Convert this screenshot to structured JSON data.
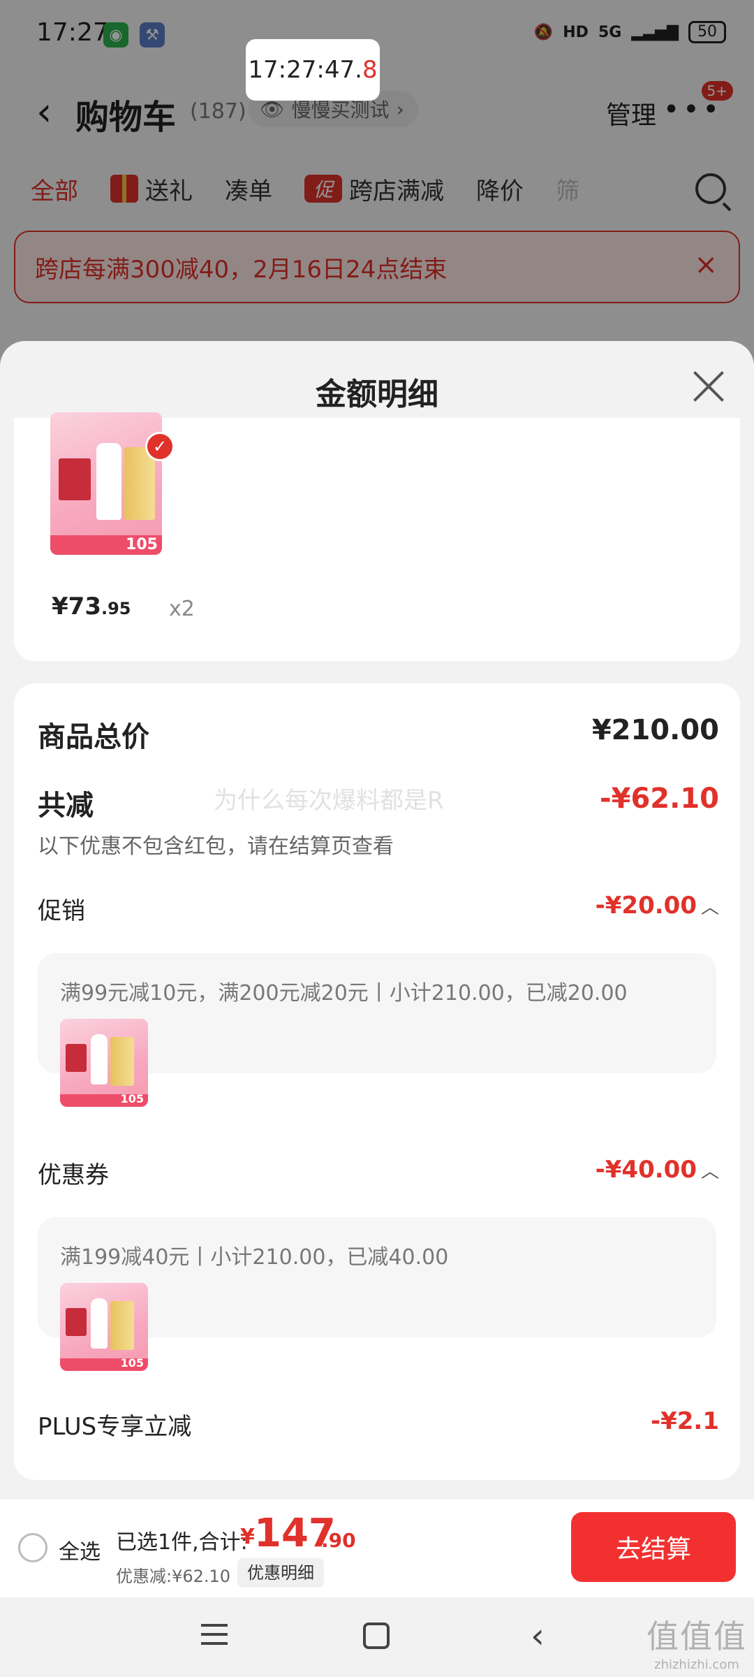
{
  "status_bar": {
    "time": "17:27",
    "wechat_icon": "wechat-icon",
    "tool_icon": "wrench-icon",
    "hd": "HD",
    "network": "5G",
    "battery": "50"
  },
  "clock_overlay": {
    "main": "17:27:47.",
    "last_digit": "8"
  },
  "cart_header": {
    "back_icon": "chevron-left-icon",
    "title": "购物车",
    "count": "(187)",
    "watch_label": "慢慢买测试",
    "manage": "管理",
    "more_badge": "5+"
  },
  "filter_tabs": {
    "all": "全部",
    "gift": "送礼",
    "bundle": "凑单",
    "promo_icon_text": "促",
    "cross_store": "跨店满减",
    "price_drop": "降价",
    "cut": "筛"
  },
  "promo_banner": {
    "text": "跨店每满300减40，2月16日24点结束",
    "close": "×"
  },
  "sheet": {
    "title": "金额明细",
    "product": {
      "price_int": "¥73",
      "price_dec": ".95",
      "qty": "x2",
      "tag_num": "105"
    },
    "summary": {
      "total_label": "商品总价",
      "total_value": "¥210.00",
      "reduce_label": "共减",
      "reduce_value": "-¥62.10",
      "note": "以下优惠不包含红包，请在结算页查看",
      "watermark": "为什么每次爆料都是R",
      "promo_label": "促销",
      "promo_value": "-¥20.00",
      "promo_detail": "满99元减10元，满200元减20元丨小计210.00，已减20.00",
      "coupon_label": "优惠券",
      "coupon_value": "-¥40.00",
      "coupon_detail": "满199减40元丨小计210.00，已减40.00",
      "plus_label": "PLUS专享立减",
      "plus_value": "-¥2.1"
    }
  },
  "checkout_bar": {
    "select_all": "全选",
    "selected": "已选1件,合计:",
    "yen": "¥",
    "total_int": "147",
    "total_dec": ".90",
    "discount": "优惠减:¥62.10",
    "detail_btn": "优惠明细",
    "checkout_btn": "去结算"
  },
  "site_mark": {
    "cn": "值值值",
    "en": "zhizhizhi.com"
  },
  "colors": {
    "accent": "#e0312a",
    "checkout": "#f23030"
  }
}
